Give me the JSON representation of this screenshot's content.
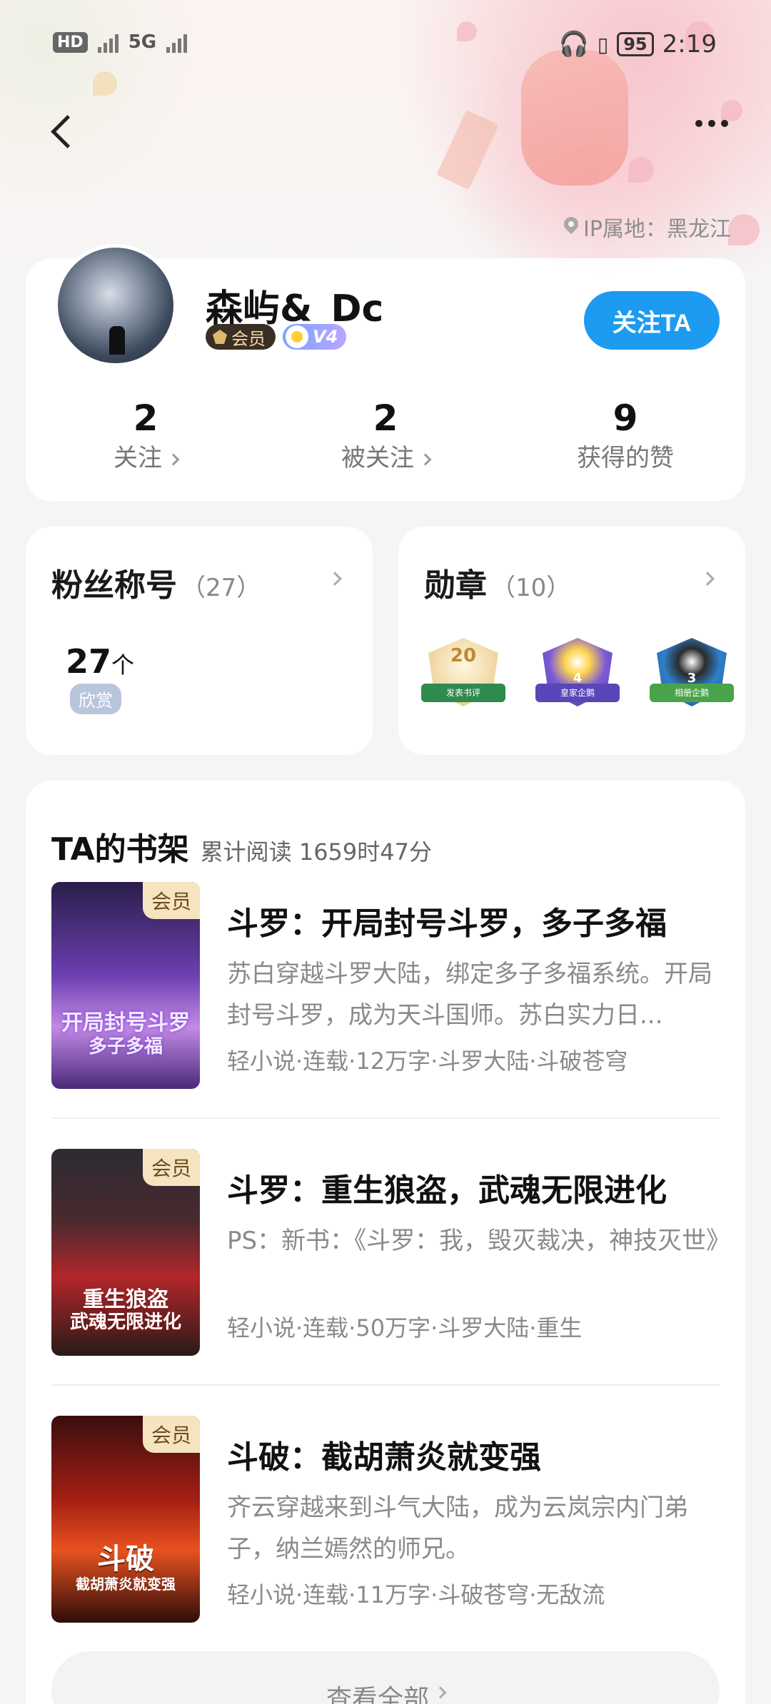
{
  "status_bar": {
    "hd_label": "HD",
    "network": "5G",
    "battery": "95",
    "time": "2:19"
  },
  "header": {
    "ip_location": "IP属地：黑龙江"
  },
  "profile": {
    "username": "森屿&_Dc",
    "vip_label": "会员",
    "level_label": "V4",
    "follow_button": "关注TA",
    "stats": [
      {
        "value": "2",
        "label": "关注"
      },
      {
        "value": "2",
        "label": "被关注"
      },
      {
        "value": "9",
        "label": "获得的赞"
      }
    ]
  },
  "fan_title": {
    "title": "粉丝称号",
    "count": "（27）",
    "value": "27",
    "unit": "个",
    "tag": "欣赏"
  },
  "medals": {
    "title": "勋章",
    "count": "（10）",
    "items": [
      {
        "icon": "review-medal-icon",
        "number": "20",
        "caption": "发表书评"
      },
      {
        "icon": "imperial-penguin-medal-icon",
        "number": "4",
        "caption": "皇家企鹅"
      },
      {
        "icon": "penguin-medal-icon",
        "number": "3",
        "caption": "相册企鹅"
      }
    ]
  },
  "bookshelf": {
    "title": "TA的书架",
    "read_time": "累计阅读 1659时47分",
    "vip_corner": "会员",
    "books": [
      {
        "title": "斗罗：开局封号斗罗，多子多福",
        "description": "苏白穿越斗罗大陆，绑定多子多福系统。开局封号斗罗，成为天斗国师。苏白实力日...",
        "meta": "轻小说·连载·12万字·斗罗大陆·斗破苍穹",
        "cover_text": [
          "开局封号斗罗",
          "多子多福"
        ]
      },
      {
        "title": "斗罗：重生狼盗，武魂无限进化",
        "description": "PS：新书：《斗罗：我，毁灭裁决，神技灭世》",
        "meta": "轻小说·连载·50万字·斗罗大陆·重生",
        "cover_text": [
          "重生狼盗",
          "武魂无限进化"
        ]
      },
      {
        "title": "斗破：截胡萧炎就变强",
        "description": "齐云穿越来到斗气大陆，成为云岚宗内门弟子，纳兰嫣然的师兄。",
        "meta": "轻小说·连载·11万字·斗破苍穹·无敌流",
        "cover_text": [
          "斗破",
          "截胡萧炎就变强"
        ]
      }
    ],
    "view_all": "查看全部"
  },
  "colors": {
    "accent": "#1d9bf0",
    "vip_bg": "#3a2f24",
    "vip_text": "#f5d9a6"
  }
}
